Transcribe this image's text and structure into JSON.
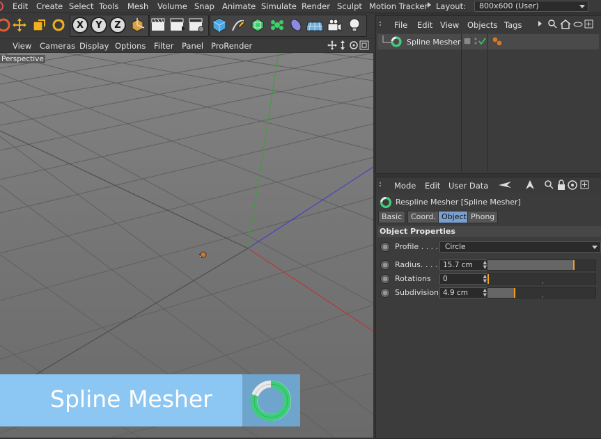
{
  "menubar": {
    "items": [
      "Edit",
      "Create",
      "Select",
      "Tools",
      "Mesh",
      "Volume",
      "Snap",
      "Animate",
      "Simulate",
      "Render",
      "Sculpt",
      "Motion Tracker"
    ],
    "layout_label": "Layout:",
    "layout_value": "800x600 (User)"
  },
  "viewport_menu": {
    "items": [
      "View",
      "Cameras",
      "Display",
      "Options",
      "Filter",
      "Panel",
      "ProRender"
    ]
  },
  "viewport": {
    "label": "Perspective",
    "banner_text": "Spline Mesher"
  },
  "object_manager": {
    "menu": [
      "File",
      "Edit",
      "View",
      "Objects",
      "Tags"
    ],
    "object_name": "Spline Mesher"
  },
  "attribute_manager": {
    "menu": [
      "Mode",
      "Edit",
      "User Data"
    ],
    "title": "Respline Mesher [Spline Mesher]",
    "tabs": [
      "Basic",
      "Coord.",
      "Object",
      "Phong"
    ],
    "active_tab": "Object",
    "section": "Object Properties",
    "profile": {
      "label": "Profile . . . .",
      "value": "Circle"
    },
    "radius": {
      "label": "Radius. . . .",
      "value": "15.7 cm",
      "level": 0.8
    },
    "rotations": {
      "label": "Rotations",
      "value": "0",
      "level": 0.0
    },
    "subdivision": {
      "label": "Subdivision",
      "value": "4.9 cm",
      "level": 0.25
    }
  },
  "colors": {
    "ui_bg": "#3a3a3a",
    "accent_blue": "#7a9fcf",
    "slider_marker": "#f0a020",
    "banner_bg": "#8cc6f2",
    "logo_green": "#3ccf7a"
  }
}
